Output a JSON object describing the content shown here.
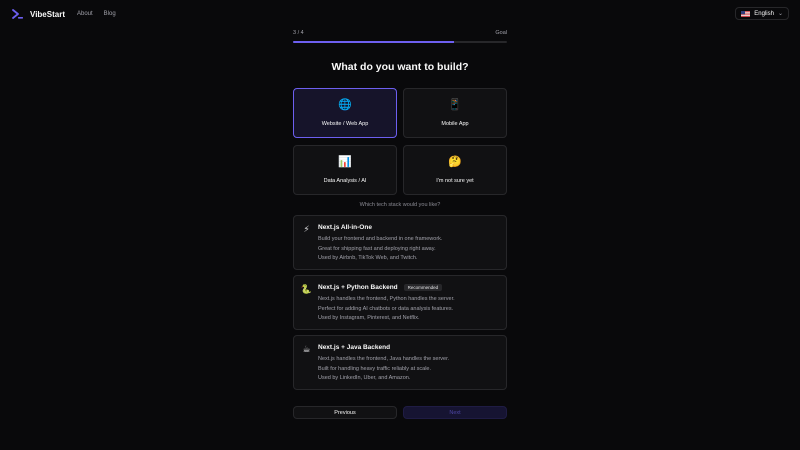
{
  "header": {
    "brand": "VibeStart",
    "nav": [
      {
        "label": "About"
      },
      {
        "label": "Blog"
      }
    ],
    "language": "English",
    "brand_color": "#6d5ff0"
  },
  "progress": {
    "step_label": "3 / 4",
    "goal_label": "Goal",
    "fraction": 0.75
  },
  "question": {
    "title": "What do you want to build?",
    "options": [
      {
        "label": "Website / Web App",
        "icon": "globe-icon",
        "glyph": "🌐",
        "selected": true
      },
      {
        "label": "Mobile App",
        "icon": "mobile-phone-icon",
        "glyph": "📱",
        "selected": false
      },
      {
        "label": "Data Analysis / AI",
        "icon": "bar-chart-icon",
        "glyph": "📊",
        "selected": false
      },
      {
        "label": "I'm not sure yet",
        "icon": "thinking-face-icon",
        "glyph": "🤔",
        "selected": false
      }
    ]
  },
  "stack_question": {
    "label": "Which tech stack would you like?",
    "stacks": [
      {
        "title": "Next.js All-in-One",
        "icon": "lightning-icon",
        "glyph": "⚡",
        "badge": "",
        "lines": [
          "Build your frontend and backend in one framework.",
          "Great for shipping fast and deploying right away.",
          "Used by Airbnb, TikTok Web, and Twitch."
        ]
      },
      {
        "title": "Next.js + Python Backend",
        "icon": "python-snake-icon",
        "glyph": "🐍",
        "badge": "Recommended",
        "lines": [
          "Next.js handles the frontend, Python handles the server.",
          "Perfect for adding AI chatbots or data analysis features.",
          "Used by Instagram, Pinterest, and Netflix."
        ]
      },
      {
        "title": "Next.js + Java Backend",
        "icon": "coffee-icon",
        "glyph": "☕",
        "badge": "",
        "lines": [
          "Next.js handles the frontend, Java handles the server.",
          "Built for handling heavy traffic reliably at scale.",
          "Used by LinkedIn, Uber, and Amazon."
        ]
      }
    ]
  },
  "footer": {
    "previous": "Previous",
    "next": "Next"
  }
}
